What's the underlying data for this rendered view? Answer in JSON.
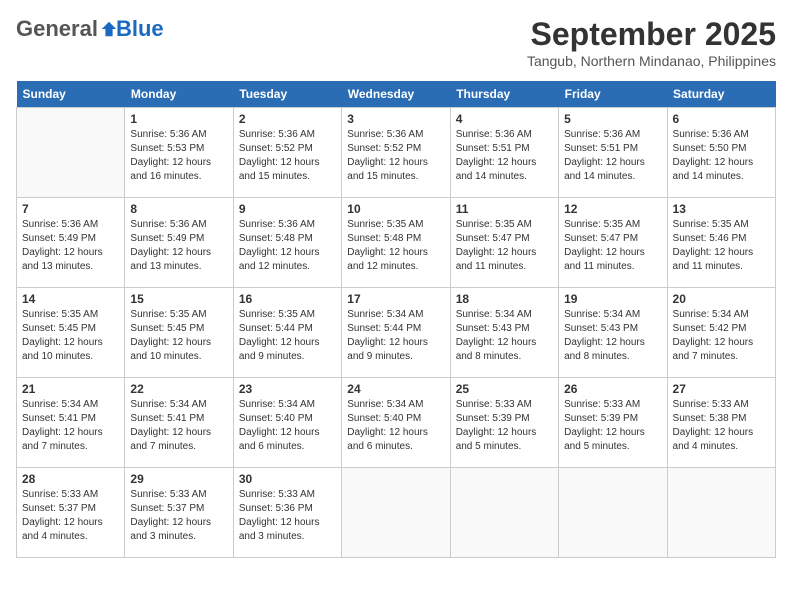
{
  "header": {
    "logo_general": "General",
    "logo_blue": "Blue",
    "month_year": "September 2025",
    "location": "Tangub, Northern Mindanao, Philippines"
  },
  "weekdays": [
    "Sunday",
    "Monday",
    "Tuesday",
    "Wednesday",
    "Thursday",
    "Friday",
    "Saturday"
  ],
  "weeks": [
    [
      {
        "day": "",
        "info": ""
      },
      {
        "day": "1",
        "info": "Sunrise: 5:36 AM\nSunset: 5:53 PM\nDaylight: 12 hours\nand 16 minutes."
      },
      {
        "day": "2",
        "info": "Sunrise: 5:36 AM\nSunset: 5:52 PM\nDaylight: 12 hours\nand 15 minutes."
      },
      {
        "day": "3",
        "info": "Sunrise: 5:36 AM\nSunset: 5:52 PM\nDaylight: 12 hours\nand 15 minutes."
      },
      {
        "day": "4",
        "info": "Sunrise: 5:36 AM\nSunset: 5:51 PM\nDaylight: 12 hours\nand 14 minutes."
      },
      {
        "day": "5",
        "info": "Sunrise: 5:36 AM\nSunset: 5:51 PM\nDaylight: 12 hours\nand 14 minutes."
      },
      {
        "day": "6",
        "info": "Sunrise: 5:36 AM\nSunset: 5:50 PM\nDaylight: 12 hours\nand 14 minutes."
      }
    ],
    [
      {
        "day": "7",
        "info": "Sunrise: 5:36 AM\nSunset: 5:49 PM\nDaylight: 12 hours\nand 13 minutes."
      },
      {
        "day": "8",
        "info": "Sunrise: 5:36 AM\nSunset: 5:49 PM\nDaylight: 12 hours\nand 13 minutes."
      },
      {
        "day": "9",
        "info": "Sunrise: 5:36 AM\nSunset: 5:48 PM\nDaylight: 12 hours\nand 12 minutes."
      },
      {
        "day": "10",
        "info": "Sunrise: 5:35 AM\nSunset: 5:48 PM\nDaylight: 12 hours\nand 12 minutes."
      },
      {
        "day": "11",
        "info": "Sunrise: 5:35 AM\nSunset: 5:47 PM\nDaylight: 12 hours\nand 11 minutes."
      },
      {
        "day": "12",
        "info": "Sunrise: 5:35 AM\nSunset: 5:47 PM\nDaylight: 12 hours\nand 11 minutes."
      },
      {
        "day": "13",
        "info": "Sunrise: 5:35 AM\nSunset: 5:46 PM\nDaylight: 12 hours\nand 11 minutes."
      }
    ],
    [
      {
        "day": "14",
        "info": "Sunrise: 5:35 AM\nSunset: 5:45 PM\nDaylight: 12 hours\nand 10 minutes."
      },
      {
        "day": "15",
        "info": "Sunrise: 5:35 AM\nSunset: 5:45 PM\nDaylight: 12 hours\nand 10 minutes."
      },
      {
        "day": "16",
        "info": "Sunrise: 5:35 AM\nSunset: 5:44 PM\nDaylight: 12 hours\nand 9 minutes."
      },
      {
        "day": "17",
        "info": "Sunrise: 5:34 AM\nSunset: 5:44 PM\nDaylight: 12 hours\nand 9 minutes."
      },
      {
        "day": "18",
        "info": "Sunrise: 5:34 AM\nSunset: 5:43 PM\nDaylight: 12 hours\nand 8 minutes."
      },
      {
        "day": "19",
        "info": "Sunrise: 5:34 AM\nSunset: 5:43 PM\nDaylight: 12 hours\nand 8 minutes."
      },
      {
        "day": "20",
        "info": "Sunrise: 5:34 AM\nSunset: 5:42 PM\nDaylight: 12 hours\nand 7 minutes."
      }
    ],
    [
      {
        "day": "21",
        "info": "Sunrise: 5:34 AM\nSunset: 5:41 PM\nDaylight: 12 hours\nand 7 minutes."
      },
      {
        "day": "22",
        "info": "Sunrise: 5:34 AM\nSunset: 5:41 PM\nDaylight: 12 hours\nand 7 minutes."
      },
      {
        "day": "23",
        "info": "Sunrise: 5:34 AM\nSunset: 5:40 PM\nDaylight: 12 hours\nand 6 minutes."
      },
      {
        "day": "24",
        "info": "Sunrise: 5:34 AM\nSunset: 5:40 PM\nDaylight: 12 hours\nand 6 minutes."
      },
      {
        "day": "25",
        "info": "Sunrise: 5:33 AM\nSunset: 5:39 PM\nDaylight: 12 hours\nand 5 minutes."
      },
      {
        "day": "26",
        "info": "Sunrise: 5:33 AM\nSunset: 5:39 PM\nDaylight: 12 hours\nand 5 minutes."
      },
      {
        "day": "27",
        "info": "Sunrise: 5:33 AM\nSunset: 5:38 PM\nDaylight: 12 hours\nand 4 minutes."
      }
    ],
    [
      {
        "day": "28",
        "info": "Sunrise: 5:33 AM\nSunset: 5:37 PM\nDaylight: 12 hours\nand 4 minutes."
      },
      {
        "day": "29",
        "info": "Sunrise: 5:33 AM\nSunset: 5:37 PM\nDaylight: 12 hours\nand 3 minutes."
      },
      {
        "day": "30",
        "info": "Sunrise: 5:33 AM\nSunset: 5:36 PM\nDaylight: 12 hours\nand 3 minutes."
      },
      {
        "day": "",
        "info": ""
      },
      {
        "day": "",
        "info": ""
      },
      {
        "day": "",
        "info": ""
      },
      {
        "day": "",
        "info": ""
      }
    ]
  ]
}
